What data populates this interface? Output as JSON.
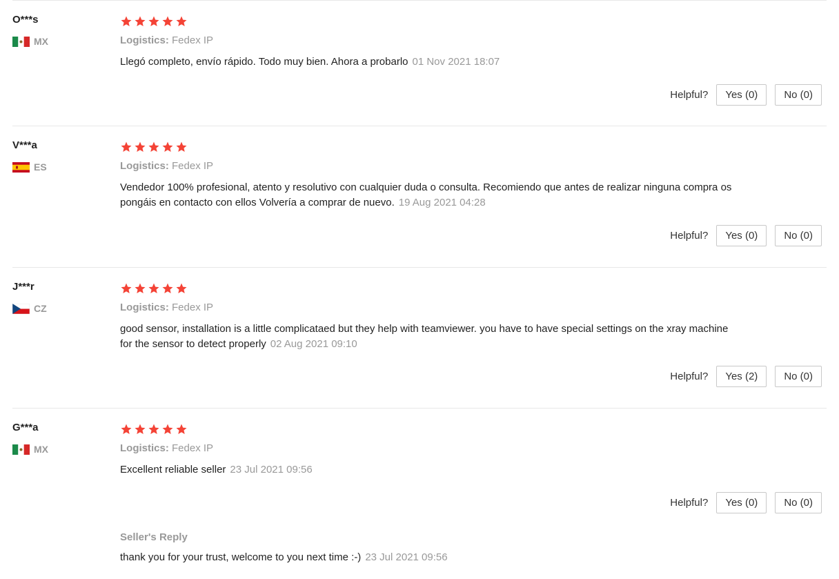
{
  "logistics_label": "Logistics:",
  "helpful_label": "Helpful?",
  "star_color": "#f44336",
  "reviews": [
    {
      "user": "O***s",
      "country": "MX",
      "flag": "mx-flag-icon",
      "rating": 5,
      "logistics": "Fedex IP",
      "text": "Llegó completo, envío rápido. Todo muy bien. Ahora a probarlo",
      "date": "01 Nov 2021 18:07",
      "yes": "Yes (0)",
      "no": "No (0)"
    },
    {
      "user": "V***a",
      "country": "ES",
      "flag": "es-flag-icon",
      "rating": 5,
      "logistics": "Fedex IP",
      "text": "Vendedor 100% profesional, atento y resolutivo con cualquier duda o consulta. Recomiendo que antes de realizar ninguna compra os pongáis en contacto con ellos Volvería a comprar de nuevo.",
      "date": "19 Aug 2021 04:28",
      "yes": "Yes (0)",
      "no": "No (0)"
    },
    {
      "user": "J***r",
      "country": "CZ",
      "flag": "cz-flag-icon",
      "rating": 5,
      "logistics": "Fedex IP",
      "text": "good sensor, installation is a little complicataed but they help with teamviewer. you have to have special settings on the xray machine for the sensor to detect properly",
      "date": "02 Aug 2021 09:10",
      "yes": "Yes (2)",
      "no": "No (0)"
    },
    {
      "user": "G***a",
      "country": "MX",
      "flag": "mx-flag-icon",
      "rating": 5,
      "logistics": "Fedex IP",
      "text": "Excellent reliable seller",
      "date": "23 Jul 2021 09:56",
      "yes": "Yes (0)",
      "no": "No (0)",
      "seller_reply": {
        "title": "Seller's Reply",
        "text": "thank you for your trust, welcome to you next time :-)",
        "date": "23 Jul 2021 09:56"
      }
    }
  ]
}
